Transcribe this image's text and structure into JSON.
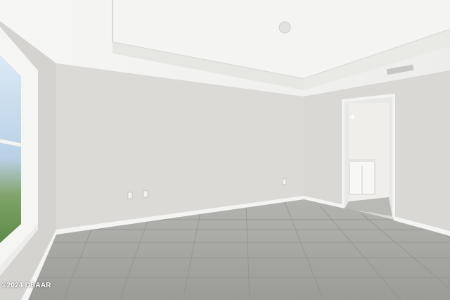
{
  "photo": {
    "subject": "empty-room",
    "watermark": "©2024 DBAAR"
  },
  "colors": {
    "ceiling": "#f1f1ef",
    "wall_back": "#dcdad6",
    "wall_left": "#d5d3cf",
    "wall_right": "#d9d8d5",
    "floor": "#a3a3a0",
    "tile_grout": "#8e8e8b",
    "baseboard": "#f4f4f2",
    "window_sky": "#cfe1f0",
    "window_foliage": "#6f9a55"
  }
}
